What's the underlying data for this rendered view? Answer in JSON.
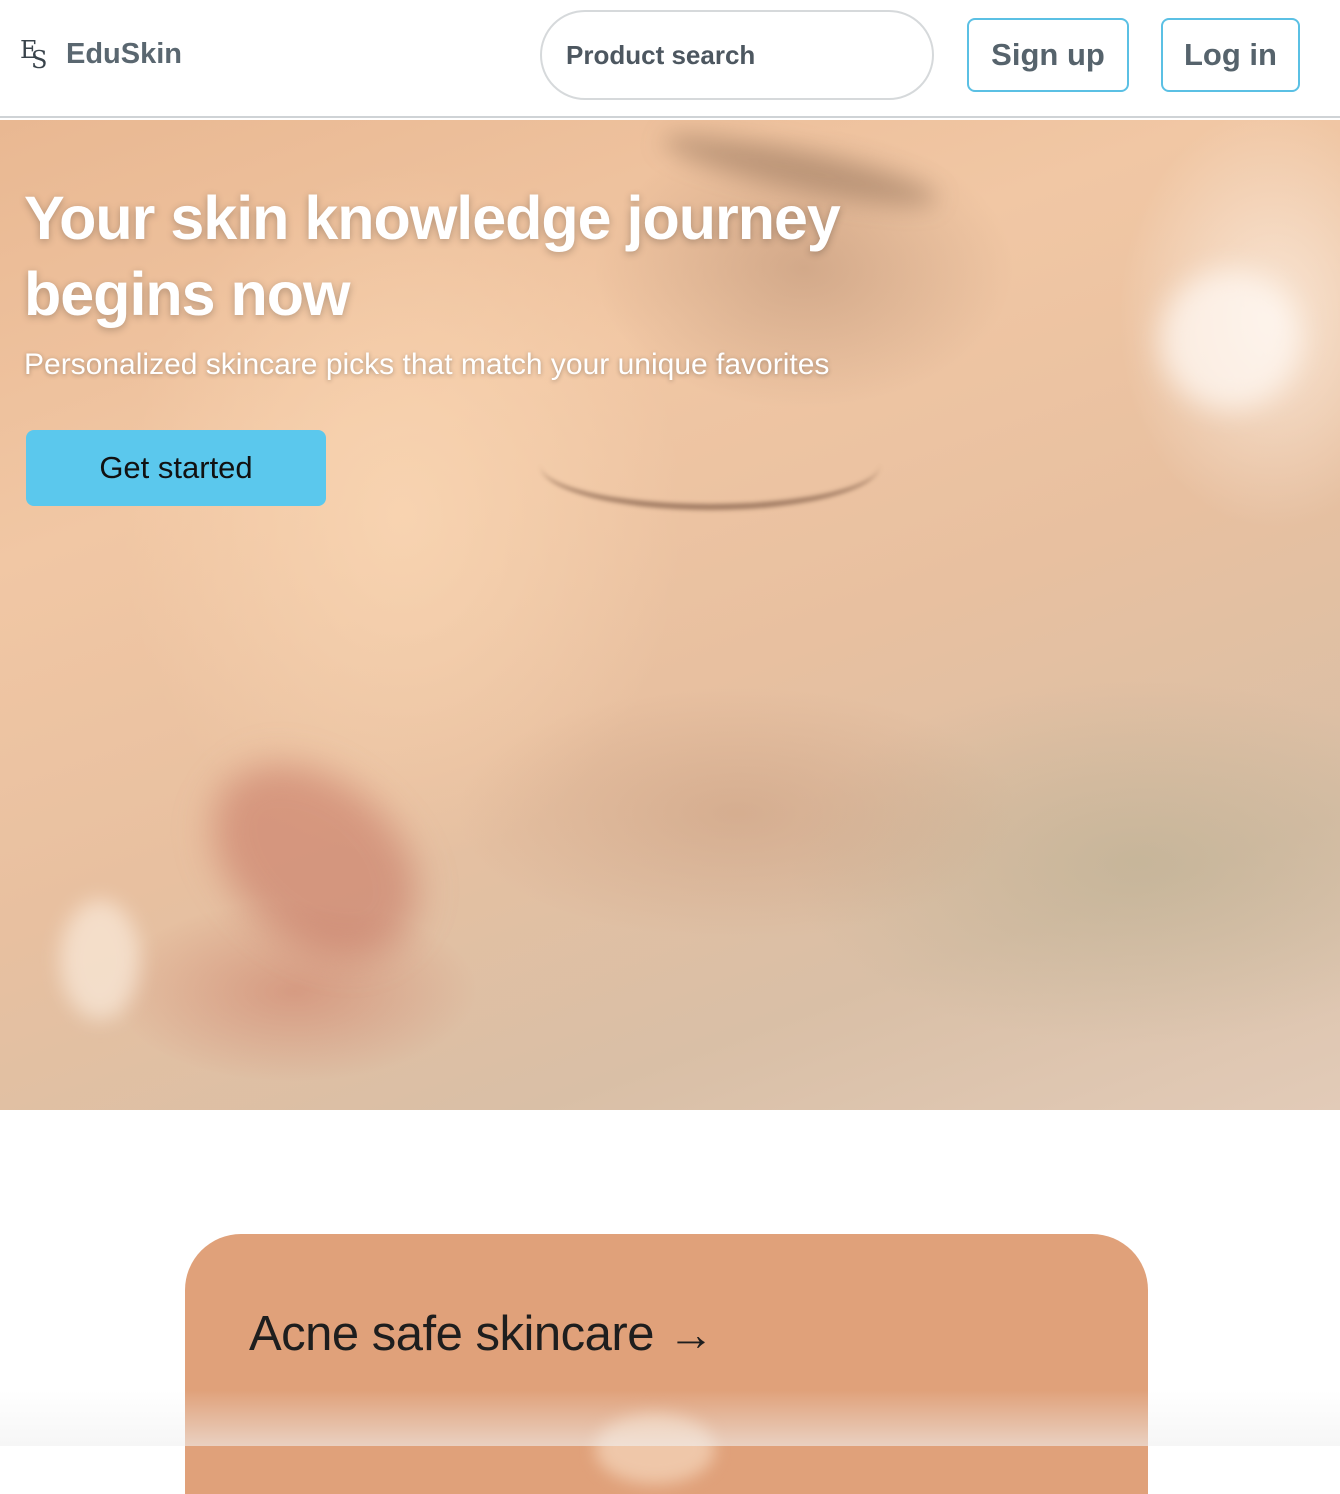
{
  "header": {
    "brand_mark_e": "E",
    "brand_mark_s": "S",
    "brand_name": "EduSkin",
    "search": {
      "placeholder": "Product search"
    },
    "signup_label": "Sign up",
    "login_label": "Log in"
  },
  "hero": {
    "title": "Your skin knowledge journey begins now",
    "subtitle": "Personalized skincare picks that match your unique favorites",
    "cta_label": "Get started"
  },
  "card": {
    "title": "Acne safe skincare",
    "arrow_icon": "→"
  },
  "colors": {
    "accent": "#5bc8ed",
    "outline": "#5bc0e4",
    "card": "#e0a17a",
    "brand_text": "#5a6770"
  }
}
